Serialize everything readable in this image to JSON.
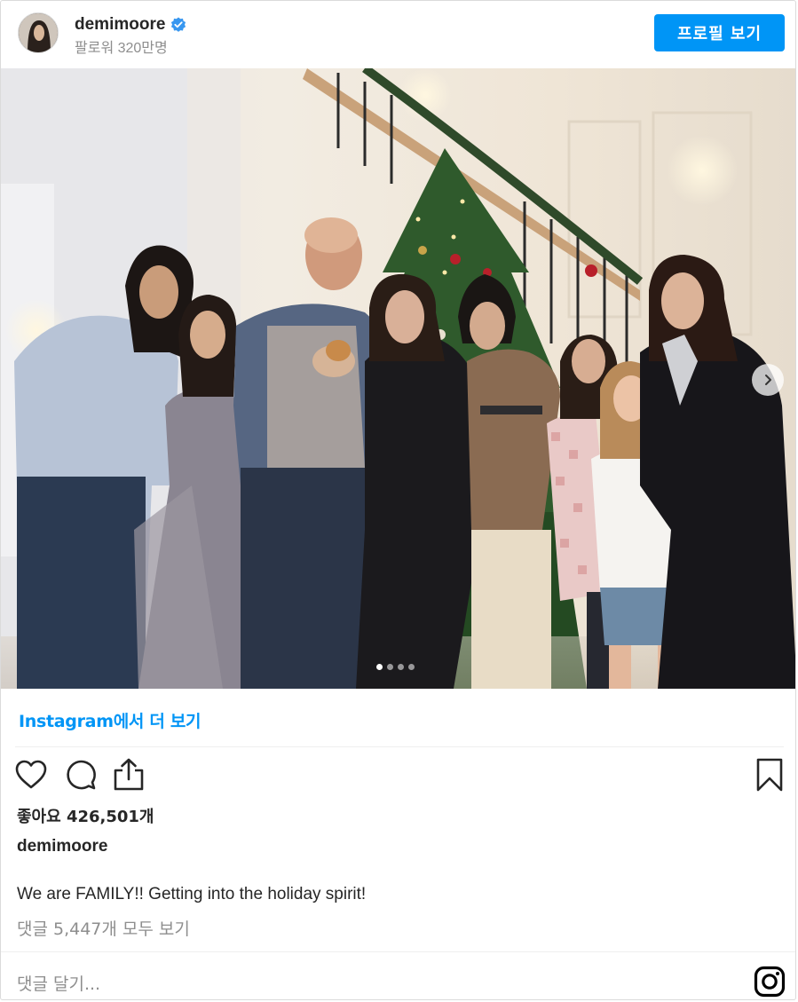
{
  "header": {
    "username": "demimoore",
    "followers": "팔로워 320만명",
    "profile_button": "프로필 보기"
  },
  "carousel": {
    "slides": 4,
    "active_index": 0
  },
  "more_on_instagram": "Instagram에서 더 보기",
  "likes": "좋아요 426,501개",
  "caption": {
    "author": "demimoore",
    "text": "We are FAMILY!! Getting into the holiday spirit!"
  },
  "comments_link": "댓글 5,447개 모두 보기",
  "comment_placeholder": "댓글 달기...",
  "colors": {
    "accent": "#0095f6",
    "text": "#262626",
    "muted": "#8e8e8e",
    "border": "#dbdbdb"
  },
  "icons": [
    "verified-icon",
    "heart-icon",
    "comment-icon",
    "share-icon",
    "bookmark-icon",
    "instagram-icon",
    "chevron-right-icon"
  ]
}
